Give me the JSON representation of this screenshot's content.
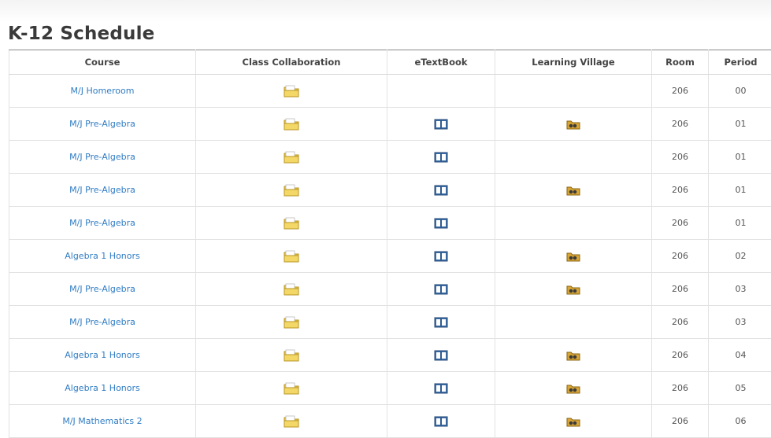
{
  "page": {
    "title": "K-12 Schedule"
  },
  "columns": {
    "course": "Course",
    "class_collaboration": "Class Collaboration",
    "etextbook": "eTextBook",
    "learning_village": "Learning Village",
    "room": "Room",
    "period": "Period"
  },
  "icons": {
    "class_collaboration": "folder-icon",
    "etextbook": "book-icon",
    "learning_village": "learning-village-folder-icon"
  },
  "rows": [
    {
      "course": "M/J Homeroom",
      "class_collaboration": true,
      "etextbook": false,
      "learning_village": false,
      "room": "206",
      "period": "00"
    },
    {
      "course": "M/J Pre-Algebra",
      "class_collaboration": true,
      "etextbook": true,
      "learning_village": true,
      "room": "206",
      "period": "01"
    },
    {
      "course": "M/J Pre-Algebra",
      "class_collaboration": true,
      "etextbook": true,
      "learning_village": false,
      "room": "206",
      "period": "01"
    },
    {
      "course": "M/J Pre-Algebra",
      "class_collaboration": true,
      "etextbook": true,
      "learning_village": true,
      "room": "206",
      "period": "01"
    },
    {
      "course": "M/J Pre-Algebra",
      "class_collaboration": true,
      "etextbook": true,
      "learning_village": false,
      "room": "206",
      "period": "01"
    },
    {
      "course": "Algebra 1 Honors",
      "class_collaboration": true,
      "etextbook": true,
      "learning_village": true,
      "room": "206",
      "period": "02"
    },
    {
      "course": "M/J Pre-Algebra",
      "class_collaboration": true,
      "etextbook": true,
      "learning_village": true,
      "room": "206",
      "period": "03"
    },
    {
      "course": "M/J Pre-Algebra",
      "class_collaboration": true,
      "etextbook": true,
      "learning_village": false,
      "room": "206",
      "period": "03"
    },
    {
      "course": "Algebra 1 Honors",
      "class_collaboration": true,
      "etextbook": true,
      "learning_village": true,
      "room": "206",
      "period": "04"
    },
    {
      "course": "Algebra 1 Honors",
      "class_collaboration": true,
      "etextbook": true,
      "learning_village": true,
      "room": "206",
      "period": "05"
    },
    {
      "course": "M/J Mathematics 2",
      "class_collaboration": true,
      "etextbook": true,
      "learning_village": true,
      "room": "206",
      "period": "06"
    }
  ],
  "colors": {
    "link": "#2f7cc4",
    "folder": "#f2d25a",
    "book": "#3d6fa8"
  }
}
